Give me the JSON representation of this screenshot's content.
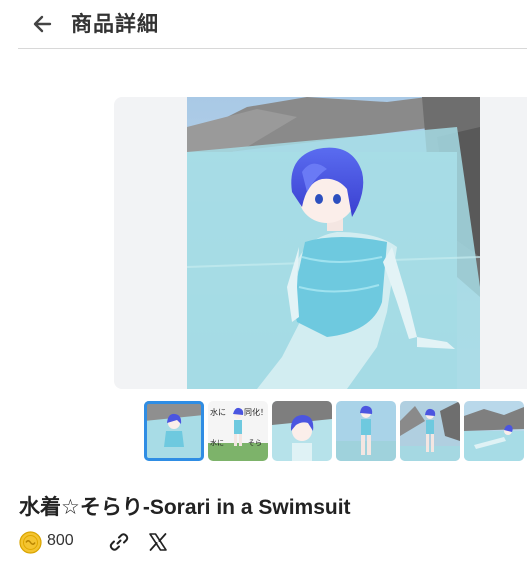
{
  "header": {
    "title": "商品詳細",
    "back_icon": "arrow-left-icon"
  },
  "gallery": {
    "main_image": "swimsuit-character-in-water",
    "selected_index": 0,
    "thumbnails": [
      {
        "name": "thumbnail-1",
        "icon": "character-in-water"
      },
      {
        "name": "thumbnail-2",
        "icon": "character-text-card",
        "text_top_left": "水に",
        "text_top_right": "同化！",
        "text_bottom_left": "水に",
        "text_bottom_right": "そら"
      },
      {
        "name": "thumbnail-3",
        "icon": "character-closeup"
      },
      {
        "name": "thumbnail-4",
        "icon": "character-standing"
      },
      {
        "name": "thumbnail-5",
        "icon": "character-standing-rocks"
      },
      {
        "name": "thumbnail-6",
        "icon": "character-lying-water"
      }
    ]
  },
  "product": {
    "title": "水着☆そらり-Sorari in a Swimsuit",
    "price": "800",
    "currency_icon": "coin-icon",
    "share_icons": [
      "link-icon",
      "x-icon"
    ]
  },
  "colors": {
    "accent": "#2f8de4",
    "coin": "#f4c430",
    "water": "#9fdde6",
    "hair": "#4b55e0"
  }
}
